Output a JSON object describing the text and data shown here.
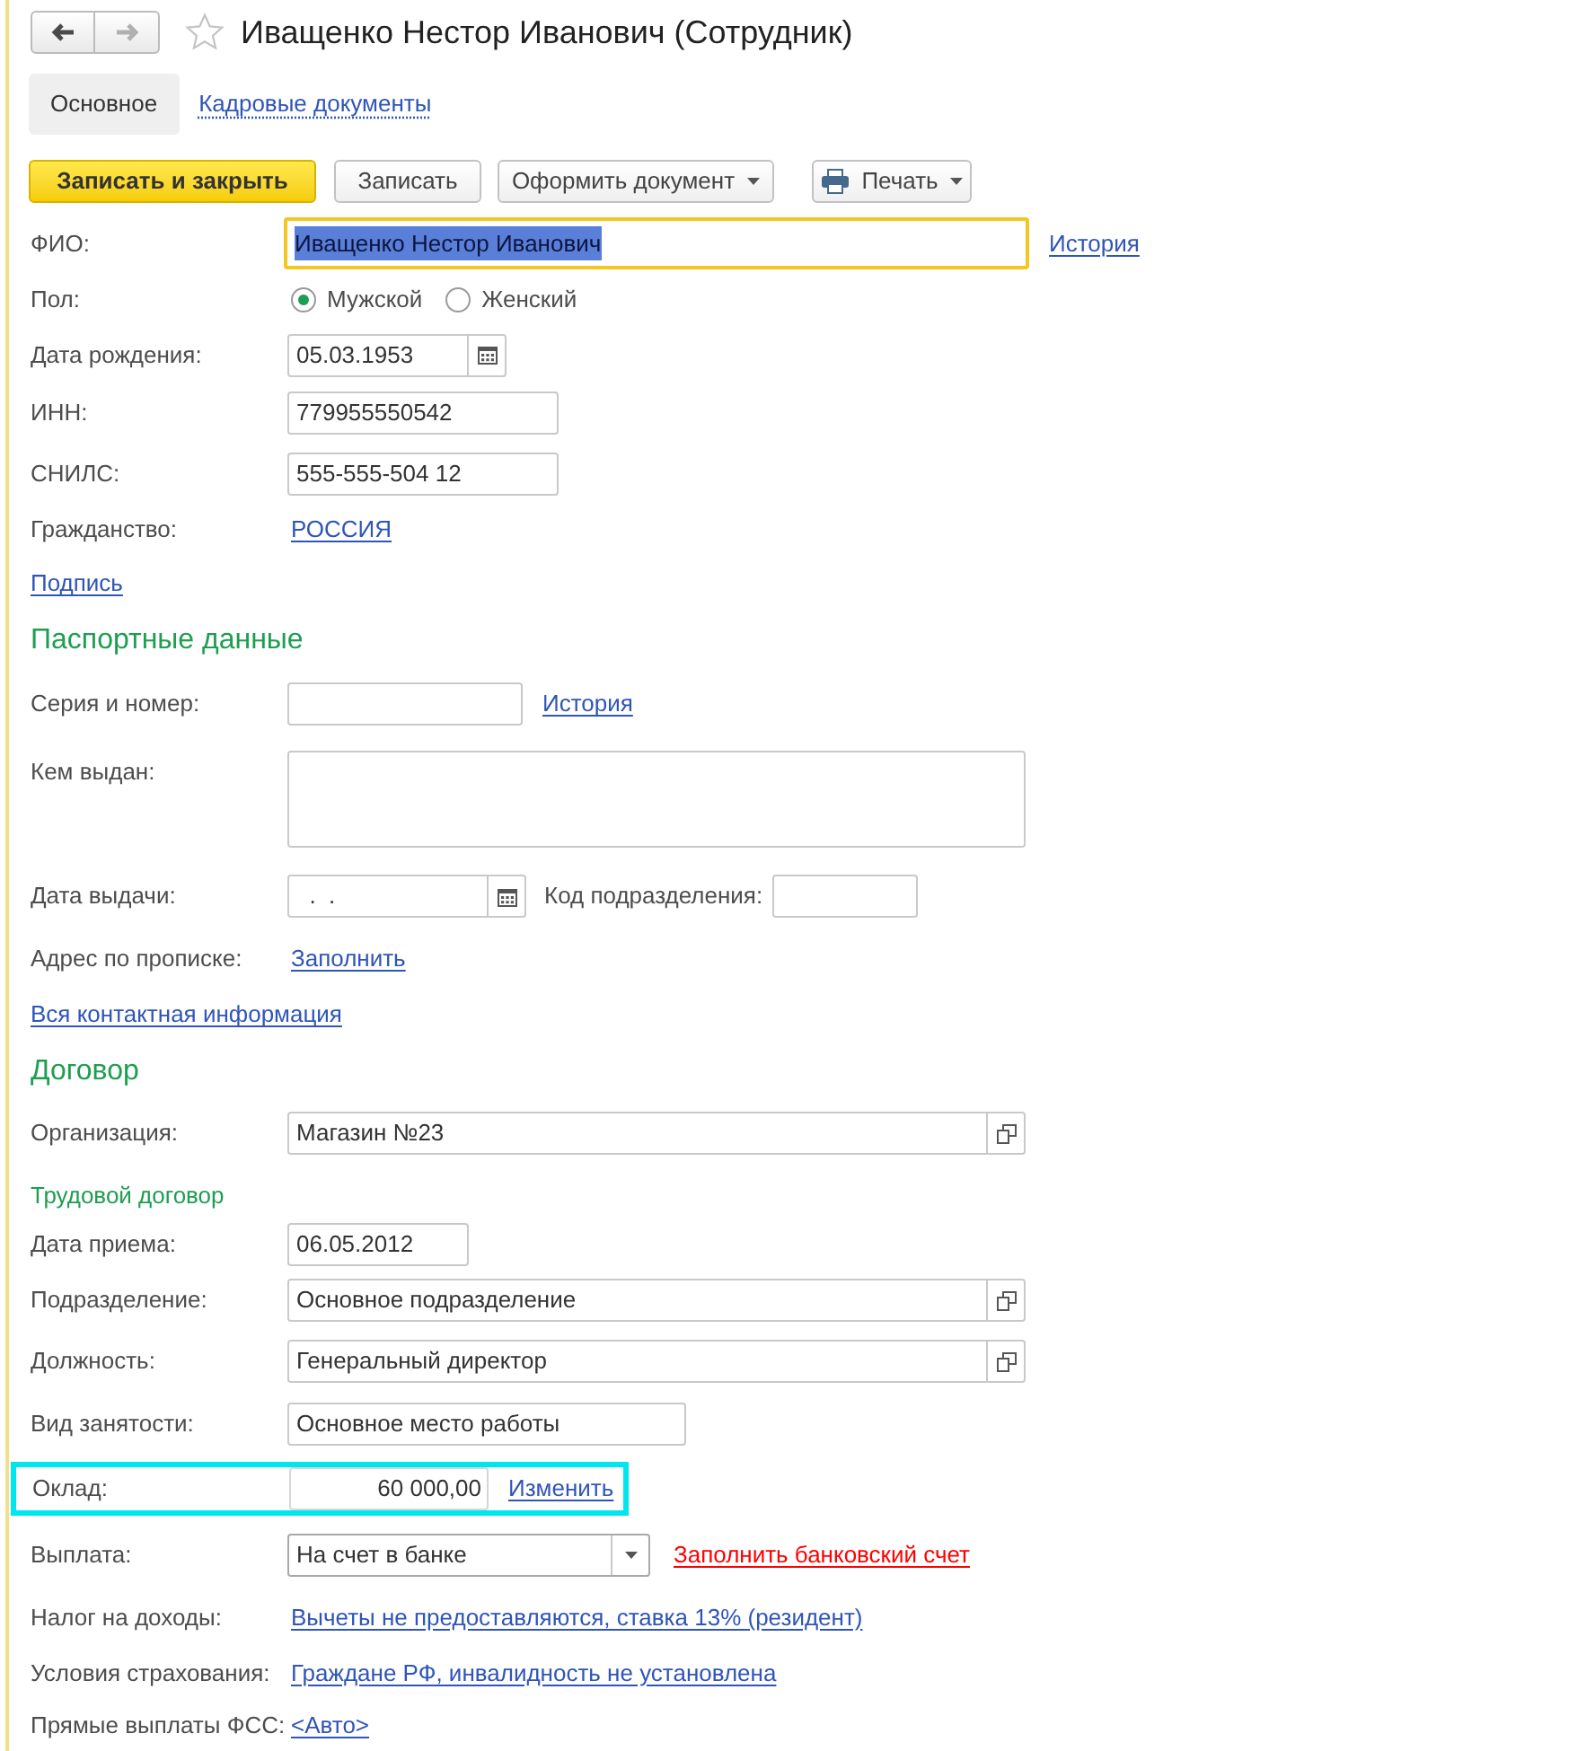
{
  "window": {
    "title": "Иващенко Нестор Иванович (Сотрудник)",
    "favorite": false
  },
  "navigation": {
    "back_enabled": true,
    "forward_enabled": false
  },
  "tabs": [
    {
      "label": "Основное",
      "selected": true
    },
    {
      "label": "Кадровые документы",
      "selected": false
    }
  ],
  "toolbar": [
    {
      "label": "Записать и закрыть",
      "kind": "primary"
    },
    {
      "label": "Записать",
      "kind": "plain"
    },
    {
      "label": "Оформить документ",
      "kind": "menu"
    },
    {
      "label": "Печать",
      "kind": "print"
    }
  ],
  "fields": [
    {
      "kind": "text",
      "label": "ФИО:",
      "value": "Иващенко Нестор Иванович",
      "focused": true,
      "value_selected": true,
      "link": "История"
    },
    {
      "kind": "radio",
      "label": "Пол:",
      "options": [
        {
          "label": "Мужской",
          "selected": true
        },
        {
          "label": "Женский",
          "selected": false
        }
      ]
    },
    {
      "kind": "date",
      "label": "Дата рождения:",
      "value": "05.03.1953"
    },
    {
      "kind": "text",
      "label": "ИНН:",
      "value": "779955550542"
    },
    {
      "kind": "text",
      "label": "СНИЛС:",
      "value": "555-555-504 12"
    },
    {
      "kind": "link",
      "label": "Гражданство:",
      "link": "РОССИЯ"
    },
    {
      "kind": "standalone_link",
      "text": "Подпись"
    },
    {
      "kind": "heading",
      "text": "Паспортные данные"
    },
    {
      "kind": "text",
      "label": "Серия и номер:",
      "link": "История"
    },
    {
      "kind": "textarea",
      "label": "Кем выдан:"
    },
    {
      "kind": "date",
      "label": "Дата выдачи:",
      "value": "  .  .",
      "second_field": {
        "label": "Код подразделения:"
      }
    },
    {
      "kind": "link",
      "label": "Адрес по прописке:",
      "link": "Заполнить"
    },
    {
      "kind": "standalone_link",
      "text": "Вся контактная информация"
    },
    {
      "kind": "heading",
      "text": "Договор"
    },
    {
      "kind": "reference",
      "label": "Организация:",
      "value": "Магазин №23"
    },
    {
      "kind": "subheading",
      "text": "Трудовой договор"
    },
    {
      "kind": "text",
      "label": "Дата приема:",
      "value": "06.05.2012"
    },
    {
      "kind": "reference",
      "label": "Подразделение:",
      "value": "Основное подразделение"
    },
    {
      "kind": "reference",
      "label": "Должность:",
      "value": "Генеральный директор"
    },
    {
      "kind": "text",
      "label": "Вид занятости:",
      "value": "Основное место работы"
    },
    {
      "kind": "number",
      "label": "Оклад:",
      "value": "60 000,00",
      "link": "Изменить",
      "highlighted": true
    },
    {
      "kind": "select",
      "label": "Выплата:",
      "value": "На счет в банке",
      "warning_link": "Заполнить банковский счет"
    },
    {
      "kind": "link",
      "label": "Налог на доходы:",
      "link": "Вычеты не предоставляются, ставка 13% (резидент)"
    },
    {
      "kind": "link",
      "label": "Условия страхования:",
      "link": "Граждане РФ, инвалидность не установлена"
    },
    {
      "kind": "link",
      "label": "Прямые выплаты ФСС:",
      "link": "<Авто>"
    }
  ]
}
